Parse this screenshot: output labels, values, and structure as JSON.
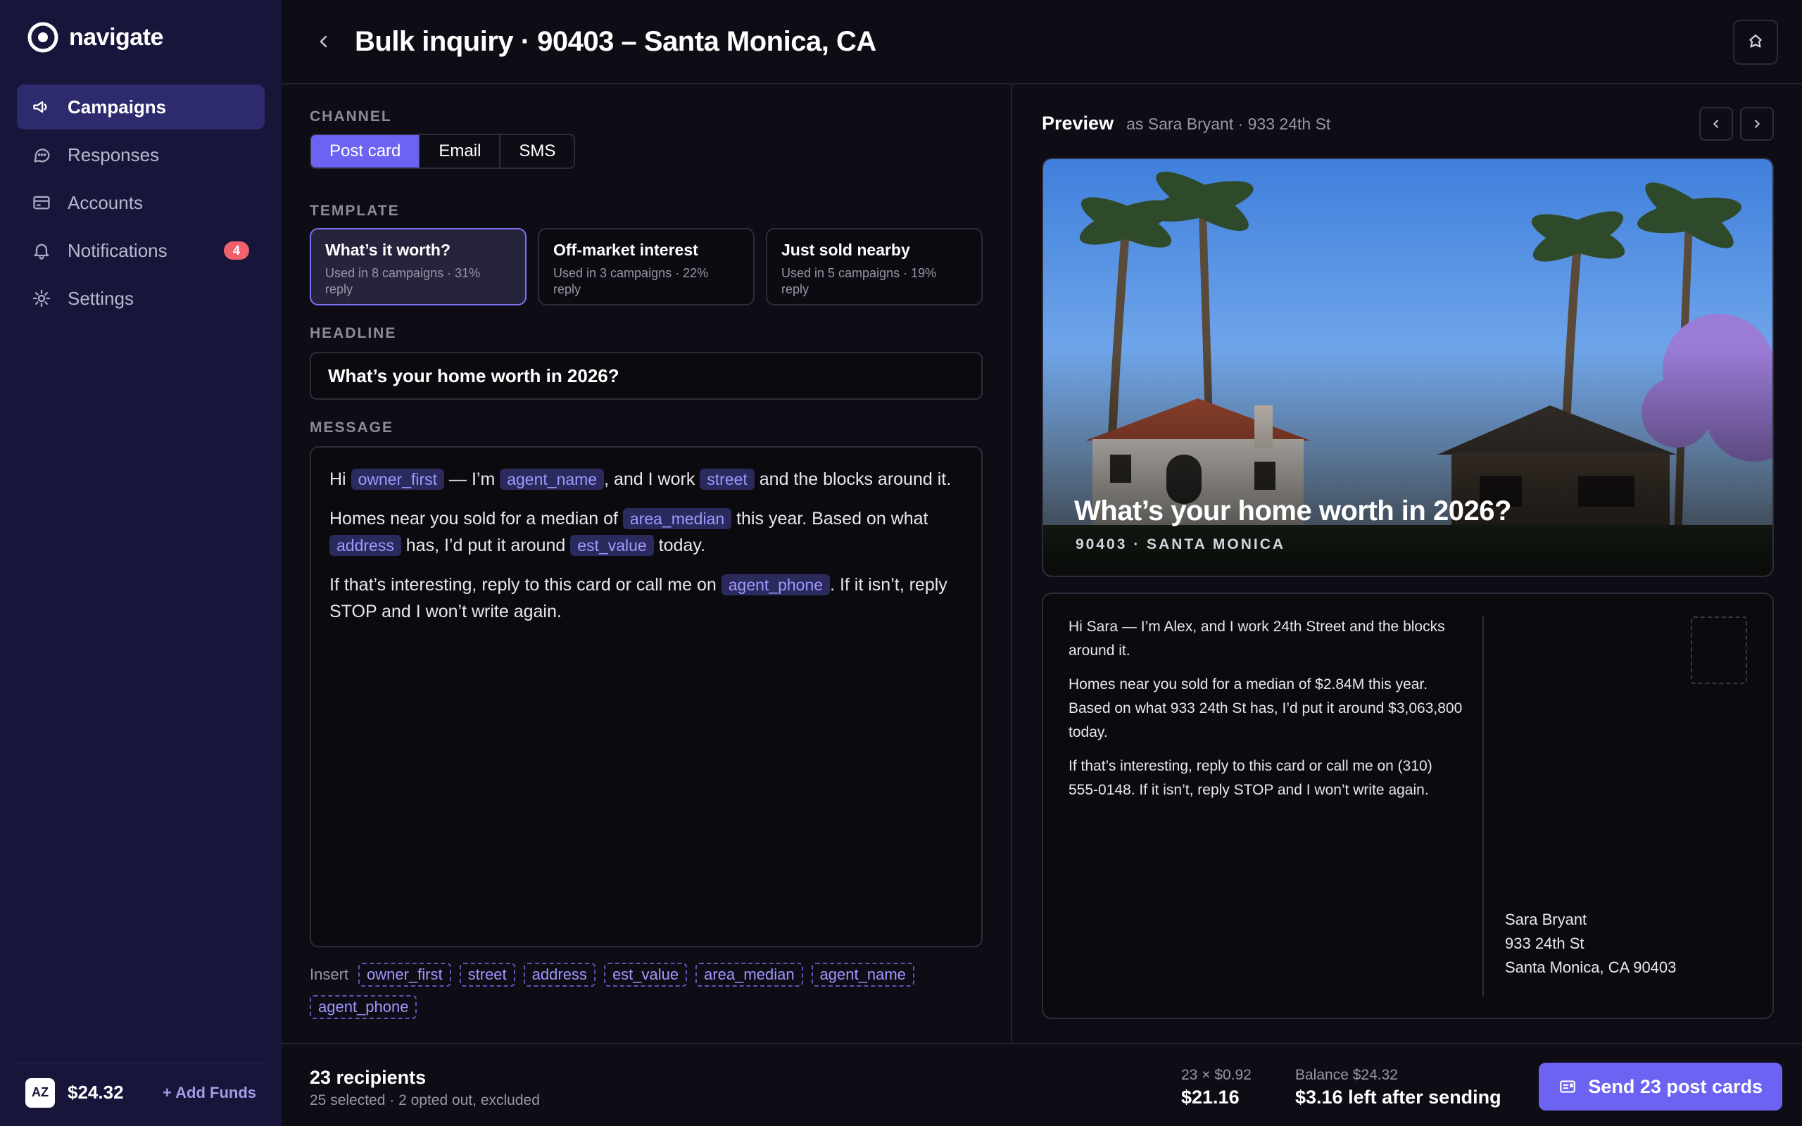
{
  "app": {
    "name": "navigate"
  },
  "sidebar": {
    "items": [
      {
        "label": "Campaigns",
        "icon": "megaphone-icon",
        "active": true
      },
      {
        "label": "Responses",
        "icon": "chat-bubble-icon"
      },
      {
        "label": "Accounts",
        "icon": "credit-card-icon"
      },
      {
        "label": "Notifications",
        "icon": "bell-icon",
        "badge": "4"
      },
      {
        "label": "Settings",
        "icon": "gear-icon"
      }
    ],
    "footer": {
      "avatar": "AZ",
      "balance": "$24.32",
      "add_funds": "+ Add Funds"
    }
  },
  "header": {
    "title": "Bulk inquiry · 90403 – Santa Monica, CA"
  },
  "editor": {
    "channel_label": "CHANNEL",
    "channels": [
      "Post card",
      "Email",
      "SMS"
    ],
    "selected_channel": "Post card",
    "template_label": "TEMPLATE",
    "templates": [
      {
        "name": "What’s it worth?",
        "meta": "Used in 8 campaigns · 31% reply"
      },
      {
        "name": "Off-market interest",
        "meta": "Used in 3 campaigns · 22% reply"
      },
      {
        "name": "Just sold nearby",
        "meta": "Used in 5 campaigns · 19% reply"
      }
    ],
    "headline_label": "HEADLINE",
    "headline": "What’s your home worth in 2026?",
    "message_label": "MESSAGE",
    "message": {
      "p1": {
        "t1": "Hi ",
        "tok1": "owner_first",
        "t2": " — I’m ",
        "tok2": "agent_name",
        "t3": ", and I work ",
        "tok3": "street",
        "t4": " and the blocks around it."
      },
      "p2": {
        "t1": "Homes near you sold for a median of ",
        "tok1": "area_median",
        "t2": " this year. Based on what ",
        "tok2": "address",
        "t3": " has, I’d put it around ",
        "tok3": "est_value",
        "t4": " today."
      },
      "p3": {
        "t1": "If that’s interesting, reply to this card or call me on ",
        "tok1": "agent_phone",
        "t2": ". If it isn’t, reply STOP and I won’t write again."
      }
    },
    "insert_label": "Insert",
    "insert_tokens": [
      "owner_first",
      "street",
      "address",
      "est_value",
      "area_median",
      "agent_name",
      "agent_phone"
    ]
  },
  "preview": {
    "title": "Preview",
    "subtitle": "as Sara Bryant · 933 24th St",
    "front_headline": "What’s your home worth in 2026?",
    "front_sub": "90403 · SANTA MONICA",
    "back_message": [
      "Hi Sara — I’m Alex, and I work 24th Street and the blocks around it.",
      "Homes near you sold for a median of $2.84M this year. Based on what 933 24th St has, I’d put it around $3,063,800 today.",
      "If that’s interesting, reply to this card or call me on (310) 555-0148. If it isn’t, reply STOP and I won’t write again."
    ],
    "address": [
      "Sara Bryant",
      "933 24th St",
      "Santa Monica, CA 90403"
    ]
  },
  "footer": {
    "recipients": "23 recipients",
    "recipients_sub": "25 selected · 2 opted out, excluded",
    "cost_formula": "23 × $0.92",
    "cost_total": "$21.16",
    "balance_label": "Balance $24.32",
    "balance_after": "$3.16 left after sending",
    "send_label": "Send 23 post cards"
  },
  "colors": {
    "accent": "#6d63f2",
    "sidebar": "#17153a",
    "badge": "#f0616d"
  }
}
